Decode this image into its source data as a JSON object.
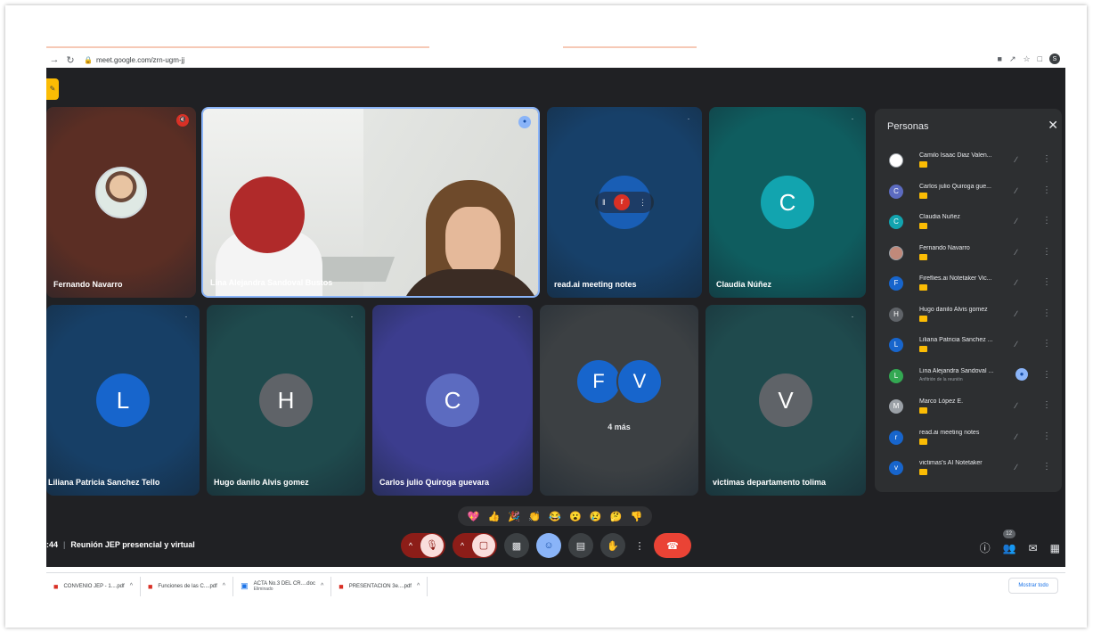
{
  "browser": {
    "url": "meet.google.com/zrn-ugm-jj",
    "back_icon": "arrow-left-icon",
    "reload_icon": "reload-icon",
    "profile_initial": "S"
  },
  "meeting": {
    "time": ":44",
    "title": "Reunión JEP presencial y virtual"
  },
  "tiles": [
    {
      "name": "Fernando Navarro",
      "bg": "#5b2e24"
    },
    {
      "name": "Lina Alejandra Sandoval Bustos"
    },
    {
      "name": "read.ai meeting notes",
      "initial": "r",
      "bg": "#174069"
    },
    {
      "name": "Claudia Núñez",
      "initial": "C",
      "bg": "#0f5d5f",
      "avatar_bg": "#12a4af"
    },
    {
      "name": "Liliana Patricia Sanchez Tello",
      "initial": "L",
      "bg": "#173f66",
      "avatar_bg": "#1765cc"
    },
    {
      "name": "Hugo danilo Alvis gomez",
      "initial": "H",
      "bg": "#1f4a4d",
      "avatar_bg": "#5f6368"
    },
    {
      "name": "Carlos julio Quiroga guevara",
      "initial": "C",
      "bg": "#3c3d8e",
      "avatar_bg": "#5c6bc0"
    },
    {
      "more_label": "4 más",
      "initials": [
        "F",
        "V"
      ],
      "bg": "#3c4043"
    },
    {
      "name": "victimas departamento tolima",
      "initial": "V",
      "bg": "#1f4a4d",
      "avatar_bg": "#5f6368"
    }
  ],
  "people_panel": {
    "title": "Personas",
    "tag": "G",
    "participants": [
      {
        "name": "Camilo Isaac Diaz Valen...",
        "initial": "",
        "color": "#ffffff",
        "icon": "photo-avatar"
      },
      {
        "name": "Carlos julio Quiroga gue...",
        "initial": "C",
        "color": "#5c6bc0"
      },
      {
        "name": "Claudia Nuñez",
        "initial": "C",
        "color": "#12a4af"
      },
      {
        "name": "Fernando Navarro",
        "initial": "",
        "color": "#c0897a",
        "icon": "photo-avatar"
      },
      {
        "name": "Fireflies.ai Notetaker Vic...",
        "initial": "F",
        "color": "#1765cc"
      },
      {
        "name": "Hugo danilo Alvis gomez",
        "initial": "H",
        "color": "#5f6368"
      },
      {
        "name": "Liliana Patricia Sanchez ...",
        "initial": "L",
        "color": "#1765cc"
      },
      {
        "name": "Lina Alejandra Sandoval ...",
        "initial": "L",
        "color": "#33a852",
        "sub": "Anfitrión de la reunión",
        "active": true
      },
      {
        "name": "Marco López E.",
        "initial": "M",
        "color": "#9aa0a6"
      },
      {
        "name": "read.ai meeting notes",
        "initial": "r",
        "color": "#1765cc"
      },
      {
        "name": "victimas's AI Notetaker",
        "initial": "v",
        "color": "#1765cc"
      }
    ]
  },
  "reactions": [
    "💖",
    "👍",
    "🎉",
    "👏",
    "😂",
    "😮",
    "😢",
    "🤔",
    "👎"
  ],
  "controls": {
    "mic_icon": "mic-off-icon",
    "cam_icon": "camera-off-icon",
    "caret": "^",
    "present_icon": "present-icon",
    "emoji_icon": "emoji-icon",
    "captions_icon": "captions-icon",
    "hand_icon": "raise-hand-icon",
    "more_icon": "more-options-icon",
    "end_icon": "end-call-icon"
  },
  "bottom_right": {
    "people_count": "12"
  },
  "downloads": [
    {
      "label": "CONVENIO JEP - 1....pdf",
      "type": "pdf"
    },
    {
      "label": "Funciones de las C....pdf",
      "type": "pdf"
    },
    {
      "label": "ACTA No.3 DEL CR....doc",
      "type": "doc",
      "sub": "Eliminado"
    },
    {
      "label": "PRESENTACION 3e....pdf",
      "type": "pdf"
    }
  ],
  "show_all_label": "Mostrar todo"
}
